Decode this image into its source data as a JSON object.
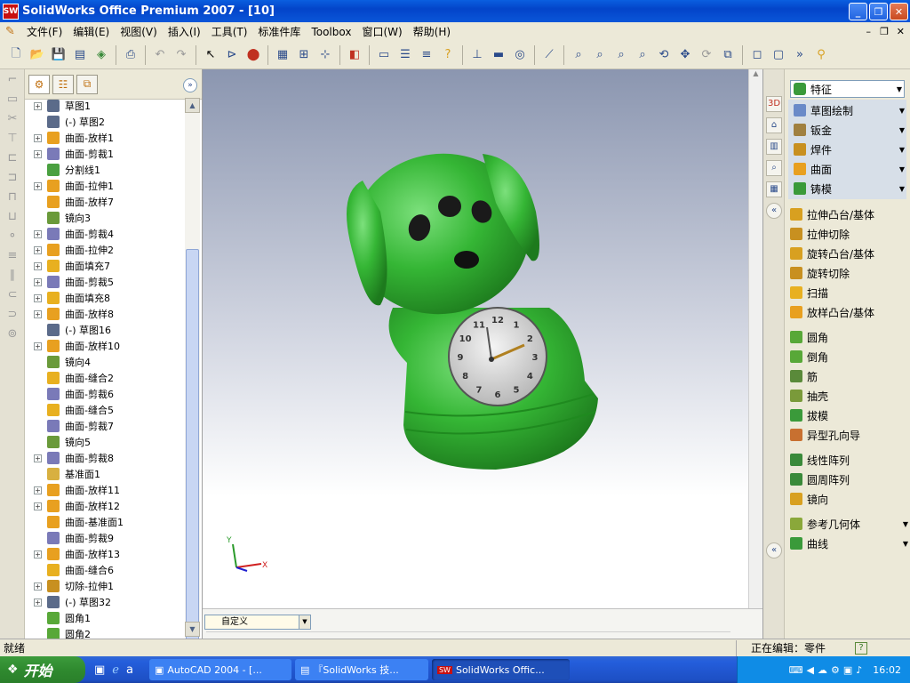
{
  "window": {
    "title": "SolidWorks Office Premium 2007 - [10]",
    "logo": "SW",
    "controls": [
      "_",
      "❐",
      "✕"
    ]
  },
  "menubar": {
    "items": [
      "文件(F)",
      "编辑(E)",
      "视图(V)",
      "插入(I)",
      "工具(T)",
      "标准件库",
      "Toolbox",
      "窗口(W)",
      "帮助(H)"
    ]
  },
  "tree": {
    "items": [
      {
        "label": "草图1",
        "expand": true,
        "icon": "sketch",
        "color": "#5b6b8a"
      },
      {
        "label": "(-) 草图2",
        "expand": false,
        "icon": "sketch",
        "color": "#5b6b8a"
      },
      {
        "label": "曲面-放样1",
        "expand": true,
        "icon": "loft",
        "color": "#e8a020"
      },
      {
        "label": "曲面-剪裁1",
        "expand": true,
        "icon": "trim",
        "color": "#7a7ab8"
      },
      {
        "label": "分割线1",
        "expand": false,
        "icon": "split",
        "color": "#4aa040"
      },
      {
        "label": "曲面-拉伸1",
        "expand": true,
        "icon": "extrude",
        "color": "#e8a020"
      },
      {
        "label": "曲面-放样7",
        "expand": false,
        "icon": "loft",
        "color": "#e8a020"
      },
      {
        "label": "镜向3",
        "expand": false,
        "icon": "mirror",
        "color": "#6a9a3a"
      },
      {
        "label": "曲面-剪裁4",
        "expand": true,
        "icon": "trim",
        "color": "#7a7ab8"
      },
      {
        "label": "曲面-拉伸2",
        "expand": true,
        "icon": "extrude",
        "color": "#e8a020"
      },
      {
        "label": "曲面填充7",
        "expand": true,
        "icon": "fill",
        "color": "#e8b020"
      },
      {
        "label": "曲面-剪裁5",
        "expand": true,
        "icon": "trim",
        "color": "#7a7ab8"
      },
      {
        "label": "曲面填充8",
        "expand": true,
        "icon": "fill",
        "color": "#e8b020"
      },
      {
        "label": "曲面-放样8",
        "expand": true,
        "icon": "loft",
        "color": "#e8a020"
      },
      {
        "label": "(-) 草图16",
        "expand": false,
        "icon": "sketch",
        "color": "#5b6b8a"
      },
      {
        "label": "曲面-放样10",
        "expand": true,
        "icon": "loft",
        "color": "#e8a020"
      },
      {
        "label": "镜向4",
        "expand": false,
        "icon": "mirror",
        "color": "#6a9a3a"
      },
      {
        "label": "曲面-缝合2",
        "expand": false,
        "icon": "knit",
        "color": "#e8b020"
      },
      {
        "label": "曲面-剪裁6",
        "expand": false,
        "icon": "trim",
        "color": "#7a7ab8"
      },
      {
        "label": "曲面-缝合5",
        "expand": false,
        "icon": "knit",
        "color": "#e8b020"
      },
      {
        "label": "曲面-剪裁7",
        "expand": false,
        "icon": "trim",
        "color": "#7a7ab8"
      },
      {
        "label": "镜向5",
        "expand": false,
        "icon": "mirror",
        "color": "#6a9a3a"
      },
      {
        "label": "曲面-剪裁8",
        "expand": true,
        "icon": "trim",
        "color": "#7a7ab8"
      },
      {
        "label": "基准面1",
        "expand": false,
        "icon": "plane",
        "color": "#d8b040"
      },
      {
        "label": "曲面-放样11",
        "expand": true,
        "icon": "loft",
        "color": "#e8a020"
      },
      {
        "label": "曲面-放样12",
        "expand": true,
        "icon": "loft",
        "color": "#e8a020"
      },
      {
        "label": "曲面-基准面1",
        "expand": false,
        "icon": "plane",
        "color": "#e8a020"
      },
      {
        "label": "曲面-剪裁9",
        "expand": false,
        "icon": "trim",
        "color": "#7a7ab8"
      },
      {
        "label": "曲面-放样13",
        "expand": true,
        "icon": "loft",
        "color": "#e8a020"
      },
      {
        "label": "曲面-缝合6",
        "expand": false,
        "icon": "knit",
        "color": "#e8b020"
      },
      {
        "label": "切除-拉伸1",
        "expand": true,
        "icon": "cut",
        "color": "#c89020"
      },
      {
        "label": "(-) 草图32",
        "expand": true,
        "icon": "sketch",
        "color": "#5b6b8a"
      },
      {
        "label": "圆角1",
        "expand": false,
        "icon": "fillet",
        "color": "#58a838"
      },
      {
        "label": "圆角2",
        "expand": false,
        "icon": "fillet",
        "color": "#58a838"
      }
    ]
  },
  "viewport": {
    "view_select": "自定义",
    "triad": {
      "x": "X",
      "y": "Y"
    },
    "model": {
      "body_color": "#35b635",
      "clock_numbers": [
        "12",
        "1",
        "2",
        "3",
        "4",
        "5",
        "6",
        "7",
        "8",
        "9",
        "10",
        "11"
      ]
    }
  },
  "command_manager": {
    "header": "特征",
    "groups": [
      "草图绘制",
      "钣金",
      "焊件",
      "曲面",
      "铸模"
    ],
    "features_1": [
      "拉伸凸台/基体",
      "拉伸切除",
      "旋转凸台/基体",
      "旋转切除",
      "扫描",
      "放样凸台/基体"
    ],
    "features_2": [
      "圆角",
      "倒角",
      "筋",
      "抽壳",
      "拔模",
      "异型孔向导"
    ],
    "features_3": [
      "线性阵列",
      "圆周阵列",
      "镜向"
    ],
    "features_4": [
      "参考几何体",
      "曲线"
    ]
  },
  "statusbar": {
    "left": "就绪",
    "right": "正在编辑：零件",
    "help": "?"
  },
  "taskbar": {
    "start": "开始",
    "tasks": [
      "AutoCAD 2004 - [...",
      "『SolidWorks 技...",
      "SolidWorks Offic..."
    ],
    "clock": "16:02"
  }
}
